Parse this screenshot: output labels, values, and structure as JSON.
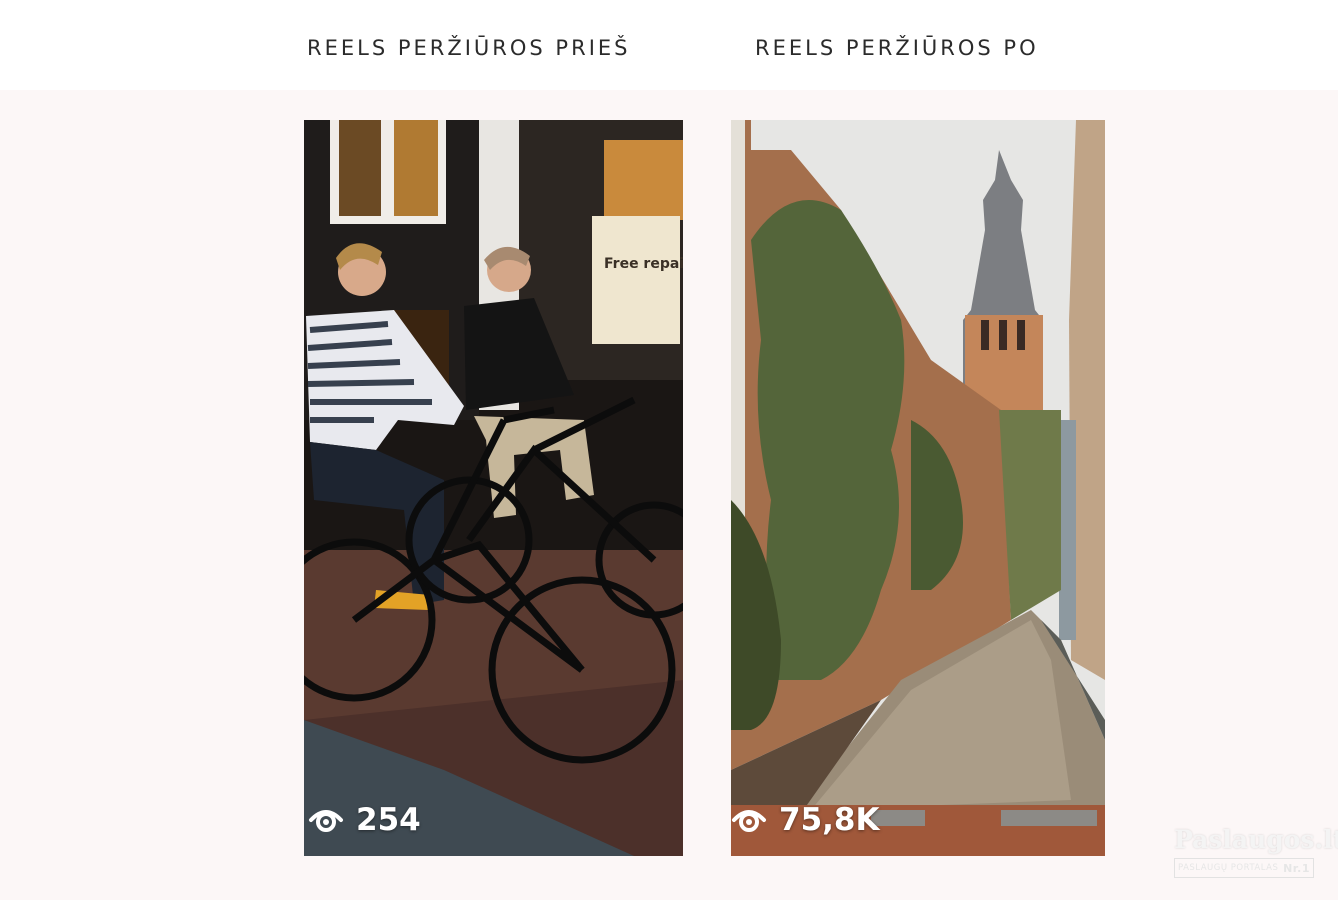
{
  "headings": {
    "before": "REELS PERŽIŪROS PRIEŠ",
    "after": "REELS PERŽIŪROS PO"
  },
  "cards": {
    "before": {
      "views": "254",
      "icon": "eye-icon",
      "sign_text": "Free repairs!"
    },
    "after": {
      "views": "75,8K",
      "icon": "eye-icon"
    }
  },
  "watermark": {
    "brand": "Paslaugos.lt",
    "tagline": "PASLAUGŲ PORTALAS",
    "badge": "Nr.1"
  },
  "colors": {
    "page_background": "#fcf7f7",
    "header_background": "#ffffff",
    "heading_text": "#2b2b2b",
    "overlay_text": "#ffffff"
  }
}
